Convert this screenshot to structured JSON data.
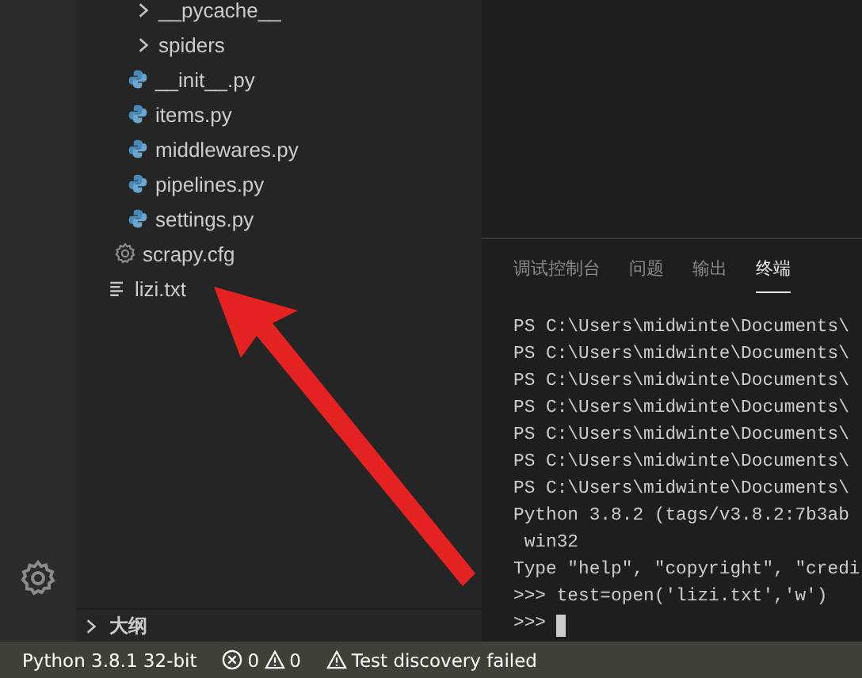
{
  "explorer": {
    "package_items": [
      {
        "label": "__pycache__",
        "kind": "folder",
        "expanded": false
      },
      {
        "label": "spiders",
        "kind": "folder",
        "expanded": false
      },
      {
        "label": "__init__.py",
        "kind": "python"
      },
      {
        "label": "items.py",
        "kind": "python"
      },
      {
        "label": "middlewares.py",
        "kind": "python"
      },
      {
        "label": "pipelines.py",
        "kind": "python"
      },
      {
        "label": "settings.py",
        "kind": "python"
      }
    ],
    "project_items": [
      {
        "label": "scrapy.cfg",
        "kind": "config"
      }
    ],
    "root_items": [
      {
        "label": "lizi.txt",
        "kind": "text"
      }
    ]
  },
  "outline": {
    "label": "大纲",
    "expanded": false
  },
  "panel": {
    "tabs": [
      {
        "label": "调试控制台",
        "selected": false
      },
      {
        "label": "问题",
        "selected": false
      },
      {
        "label": "输出",
        "selected": false
      },
      {
        "label": "终端",
        "selected": true
      }
    ],
    "terminal_lines": [
      "PS C:\\Users\\midwinte\\Documents\\",
      "PS C:\\Users\\midwinte\\Documents\\",
      "PS C:\\Users\\midwinte\\Documents\\",
      "PS C:\\Users\\midwinte\\Documents\\",
      "PS C:\\Users\\midwinte\\Documents\\",
      "PS C:\\Users\\midwinte\\Documents\\",
      "PS C:\\Users\\midwinte\\Documents\\",
      "Python 3.8.2 (tags/v3.8.2:7b3ab",
      " win32",
      "Type \"help\", \"copyright\", \"credi",
      ">>> test=open('lizi.txt','w')"
    ],
    "prompt": ">>> "
  },
  "status_bar": {
    "interpreter": "Python 3.8.1 32-bit",
    "errors": "0",
    "warnings": "0",
    "message": "Test discovery failed"
  }
}
